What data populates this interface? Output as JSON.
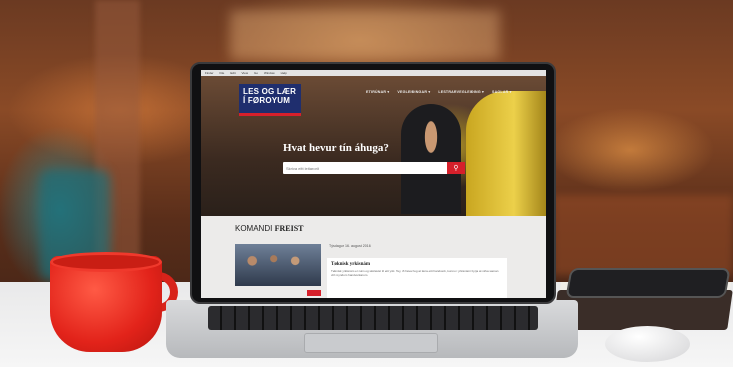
{
  "site": {
    "logo_line1": "LES OG LÆR",
    "logo_line2": "Í FØROYUM",
    "nav": [
      "ETIRÚNAR ▾",
      "VEGLEIÐINGAR ▾",
      "LESTRARVEGLEIÐING ▾",
      "SAGLAR ▾"
    ],
    "hero_title": "Hvat hevur tín áhuga?",
    "search_placeholder": "Skriva eitt leitarorð",
    "section_title_1": "KOMANDI",
    "section_title_2": "FREIST",
    "card_date": "Týsdagur 16. august 2016",
    "card_title": "Tøknisk yrkisnám",
    "card_text": "Tøknisk yrkisnám er nám og skúlavist til eitt yrki. Tey, ið hava hug at læra eitt handverk, kunnu í yrkisnámi byrja at virka saman við royndum handverkarum."
  },
  "menubar": [
    "Finder",
    "File",
    "Edit",
    "View",
    "Go",
    "Window",
    "Help"
  ],
  "colors": {
    "brand_navy": "#1f2e6e",
    "brand_red": "#d6202b",
    "mug_red": "#e2231a"
  }
}
